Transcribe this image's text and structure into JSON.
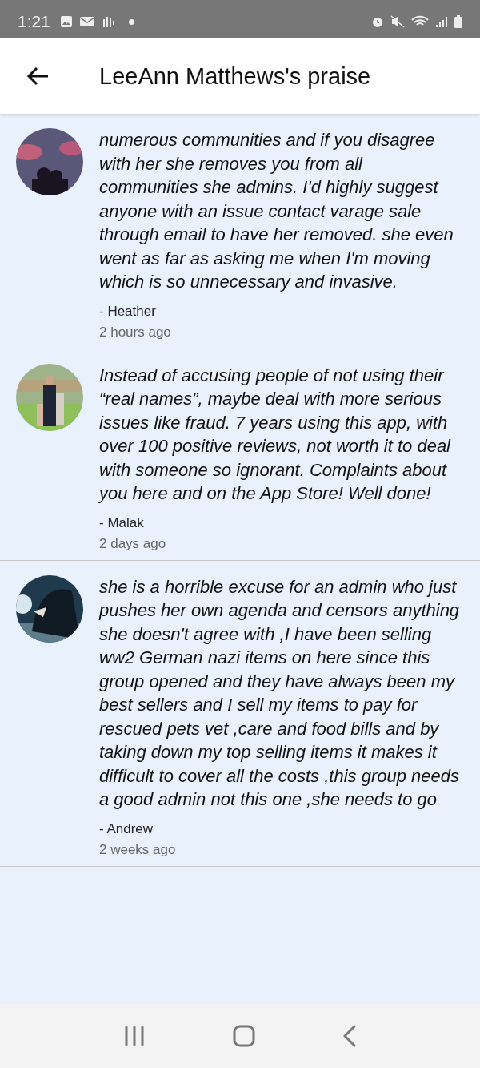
{
  "status_bar": {
    "time": "1:21"
  },
  "header": {
    "title": "LeeAnn Matthews's praise"
  },
  "reviews": [
    {
      "text": "numerous communities and if you disagree with her she removes you from all communities she admins. I'd highly suggest anyone with an issue contact varage sale through email to have her removed. she even went as far as asking me when I'm moving which is so unnecessary and invasive.",
      "author": "- Heather",
      "time": "2 hours ago"
    },
    {
      "text": "Instead of accusing people of not using their “real names”, maybe deal with more serious issues like fraud. 7 years using this app, with over 100 positive reviews, not worth it to deal with someone so ignorant. Complaints about you here and on the App Store! Well done!",
      "author": "- Malak",
      "time": "2 days ago"
    },
    {
      "text": "she is a horrible excuse for an admin who just pushes her own agenda and censors anything she doesn't agree with ,I have been selling ww2 German nazi items on here since this group opened and they have always been my best sellers and I sell my items to pay for rescued pets vet ,care and food bills and by taking down my top selling items it makes it difficult to cover all the costs ,this group needs a good admin not this one ,she needs to go",
      "author": "- Andrew",
      "time": "2 weeks ago"
    }
  ]
}
